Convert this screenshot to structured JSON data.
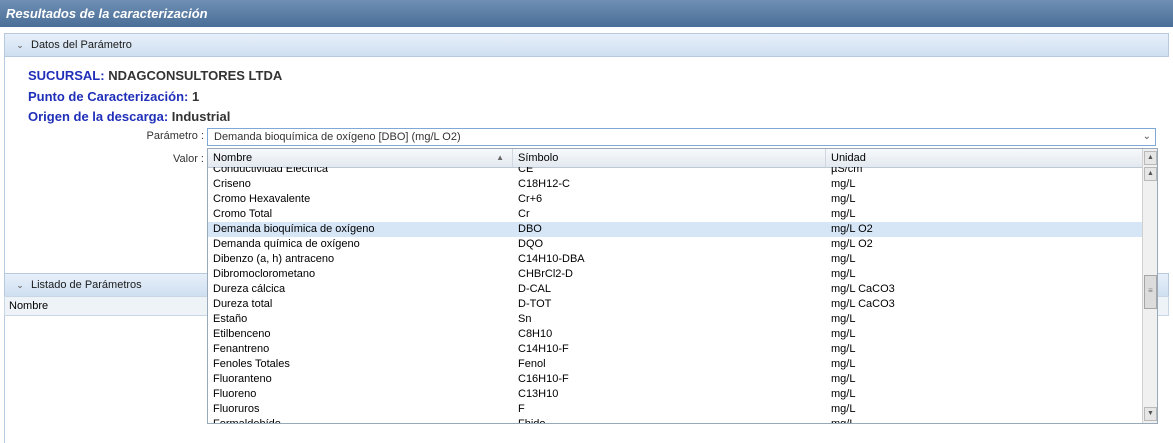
{
  "window": {
    "title": "Resultados de la caracterización"
  },
  "datos_section": {
    "title": "Datos del Parámetro"
  },
  "info": {
    "sucursal_label": "SUCURSAL:",
    "sucursal_value": "NDAGCONSULTORES LTDA",
    "punto_label": "Punto de Caracterización:",
    "punto_value": "1",
    "origen_label": "Origen de la descarga:",
    "origen_value": "Industrial"
  },
  "form": {
    "parametro_label": "Parámetro :",
    "parametro_value": "Demanda bioquímica de oxígeno [DBO] (mg/L O2)",
    "valor_label": "Valor :"
  },
  "listado_section": {
    "title": "Listado de Parámetros",
    "column_nombre": "Nombre"
  },
  "dropdown": {
    "columns": [
      "Nombre",
      "Símbolo",
      "Unidad"
    ],
    "selected_index": 4,
    "rows": [
      {
        "nombre": "Conductividad Eléctrica",
        "simbolo": "CE",
        "unidad": "µS/cm"
      },
      {
        "nombre": "Criseno",
        "simbolo": "C18H12-C",
        "unidad": "mg/L"
      },
      {
        "nombre": "Cromo Hexavalente",
        "simbolo": "Cr+6",
        "unidad": "mg/L"
      },
      {
        "nombre": "Cromo Total",
        "simbolo": "Cr",
        "unidad": "mg/L"
      },
      {
        "nombre": "Demanda bioquímica de oxígeno",
        "simbolo": "DBO",
        "unidad": "mg/L O2"
      },
      {
        "nombre": "Demanda química de oxígeno",
        "simbolo": "DQO",
        "unidad": "mg/L O2"
      },
      {
        "nombre": "Dibenzo (a, h) antraceno",
        "simbolo": "C14H10-DBA",
        "unidad": "mg/L"
      },
      {
        "nombre": "Dibromoclorometano",
        "simbolo": "CHBrCl2-D",
        "unidad": "mg/L"
      },
      {
        "nombre": "Dureza cálcica",
        "simbolo": "D-CAL",
        "unidad": "mg/L CaCO3"
      },
      {
        "nombre": "Dureza total",
        "simbolo": "D-TOT",
        "unidad": "mg/L CaCO3"
      },
      {
        "nombre": "Estaño",
        "simbolo": "Sn",
        "unidad": "mg/L"
      },
      {
        "nombre": "Etilbenceno",
        "simbolo": "C8H10",
        "unidad": "mg/L"
      },
      {
        "nombre": "Fenantreno",
        "simbolo": "C14H10-F",
        "unidad": "mg/L"
      },
      {
        "nombre": "Fenoles Totales",
        "simbolo": "Fenol",
        "unidad": "mg/L"
      },
      {
        "nombre": "Fluoranteno",
        "simbolo": "C16H10-F",
        "unidad": "mg/L"
      },
      {
        "nombre": "Fluoreno",
        "simbolo": "C13H10",
        "unidad": "mg/L"
      },
      {
        "nombre": "Fluoruros",
        "simbolo": "F",
        "unidad": "mg/L"
      },
      {
        "nombre": "Formaldehído",
        "simbolo": "Fhido",
        "unidad": "mg/L"
      }
    ]
  }
}
